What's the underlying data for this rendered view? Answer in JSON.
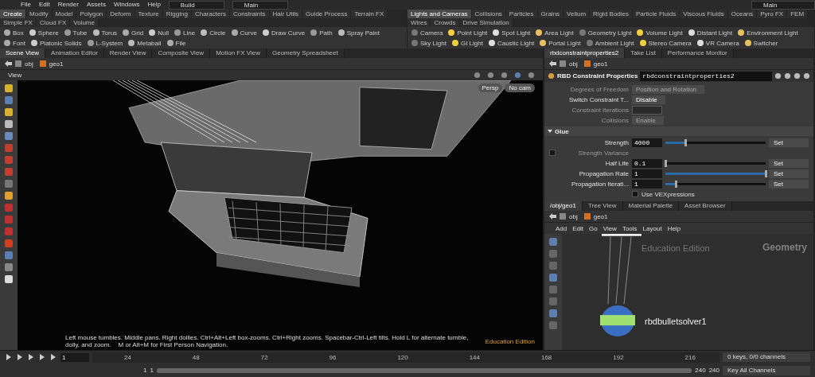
{
  "menu": [
    "File",
    "Edit",
    "Render",
    "Assets",
    "Windows",
    "Help"
  ],
  "desktops": [
    "Build",
    "Main",
    "Main"
  ],
  "shelf_left": {
    "tabs": [
      {
        "label": "Create",
        "selected": true
      },
      {
        "label": "Modify",
        "selected": false
      },
      {
        "label": "Model",
        "selected": false
      },
      {
        "label": "Polygon",
        "selected": false
      },
      {
        "label": "Deform",
        "selected": false
      },
      {
        "label": "Texture",
        "selected": false
      },
      {
        "label": "Rigging",
        "selected": false
      },
      {
        "label": "Characters",
        "selected": false
      },
      {
        "label": "Constraints",
        "selected": false
      },
      {
        "label": "Hair Utils",
        "selected": false
      },
      {
        "label": "Guide Process",
        "selected": false
      },
      {
        "label": "Terrain FX",
        "selected": false
      },
      {
        "label": "Simple FX",
        "selected": false
      },
      {
        "label": "Cloud FX",
        "selected": false
      },
      {
        "label": "Volume",
        "selected": false
      }
    ],
    "tools": [
      "Box",
      "Sphere",
      "Tube",
      "Torus",
      "Grid",
      "Null",
      "Line",
      "Circle",
      "Curve",
      "Draw Curve",
      "Path",
      "Spray Paint",
      "Font",
      "Platonic Solids",
      "L-System",
      "Metaball",
      "File"
    ]
  },
  "shelf_right": {
    "tabs": [
      {
        "label": "Lights and Cameras",
        "selected": true
      },
      {
        "label": "Collisions",
        "selected": false
      },
      {
        "label": "Particles",
        "selected": false
      },
      {
        "label": "Grains",
        "selected": false
      },
      {
        "label": "Vellum",
        "selected": false
      },
      {
        "label": "Rigid Bodies",
        "selected": false
      },
      {
        "label": "Particle Fluids",
        "selected": false
      },
      {
        "label": "Viscous Fluids",
        "selected": false
      },
      {
        "label": "Oceans",
        "selected": false
      },
      {
        "label": "Pyro FX",
        "selected": false
      },
      {
        "label": "FEM",
        "selected": false
      },
      {
        "label": "Wires",
        "selected": false
      },
      {
        "label": "Crowds",
        "selected": false
      },
      {
        "label": "Drive Simulation",
        "selected": false
      }
    ],
    "tools": [
      "Camera",
      "Point Light",
      "Spot Light",
      "Area Light",
      "Geometry Light",
      "Volume Light",
      "Distant Light",
      "Environment Light",
      "Sky Light",
      "GI Light",
      "Caustic Light",
      "Portal Light",
      "Ambient Light",
      "Stereo Camera",
      "VR Camera",
      "Switcher"
    ]
  },
  "scene_pane": {
    "tabs": [
      {
        "label": "Scene View",
        "selected": true
      },
      {
        "label": "Animation Editor",
        "selected": false
      },
      {
        "label": "Render View",
        "selected": false
      },
      {
        "label": "Composite View",
        "selected": false
      },
      {
        "label": "Motion FX View",
        "selected": false
      },
      {
        "label": "Geometry Spreadsheet",
        "selected": false
      }
    ],
    "path": [
      "obj",
      "geo1"
    ],
    "view_title": "View",
    "view_buttons": [
      "Persp",
      "No cam"
    ],
    "hint": "Left mouse tumbles. Middle pans. Right dollies. Ctrl+Alt+Left box-zooms. Ctrl+Right zooms. Spacebar-Ctrl-Left tilts. Hold L for alternate tumble, dolly, and zoom.    M or Alt+M for First Person Navigation.",
    "edition": "Education Edition"
  },
  "param_pane": {
    "tabs": [
      {
        "label": "rbdconstraintproperties2",
        "selected": true
      },
      {
        "label": "Take List",
        "selected": false
      },
      {
        "label": "Performance Monitor",
        "selected": false
      }
    ],
    "path": [
      "obj",
      "geo1"
    ],
    "node_type": "RBD Constraint Properties",
    "node_name": "rbdconstraintproperties2",
    "params": [
      {
        "kind": "menu",
        "label": "Degrees of Freedom",
        "value": "Position and Rotation",
        "disabled": true
      },
      {
        "kind": "menu",
        "label": "Switch Constraint T...",
        "value": "Disable",
        "disabled": false
      },
      {
        "kind": "field",
        "label": "Constraint Iterations",
        "disabled": true
      },
      {
        "kind": "menu",
        "label": "Collisions",
        "value": "Enable",
        "disabled": true
      }
    ],
    "section": {
      "label": "Glue",
      "expanded": true
    },
    "glue": [
      {
        "label": "Strength",
        "value": "4000",
        "level": 0.2,
        "mode": "Set",
        "disabled": false
      },
      {
        "label": "Strength Variance",
        "disabled": true,
        "checked": false
      },
      {
        "label": "Half Life",
        "value": "0.1",
        "level": 0.0,
        "mode": "Set",
        "disabled": false
      },
      {
        "label": "Propagation Rate",
        "value": "1",
        "level": 1.0,
        "mode": "Set",
        "disabled": false
      },
      {
        "label": "Propagation Iterati...",
        "value": "1",
        "level": 0.1,
        "mode": "Set",
        "disabled": false
      }
    ],
    "vex": {
      "label": "Use VEXpressions",
      "checked": false
    }
  },
  "network_pane": {
    "tabs": [
      {
        "label": "/obj/geo1",
        "selected": true
      },
      {
        "label": "Tree View",
        "selected": false
      },
      {
        "label": "Material Palette",
        "selected": false
      },
      {
        "label": "Asset Browser",
        "selected": false
      }
    ],
    "path": [
      "obj",
      "geo1"
    ],
    "menu": [
      "Add",
      "Edit",
      "Go",
      "View",
      "Tools",
      "Layout",
      "Help"
    ],
    "watermark": "Education Edition",
    "context": "Geometry",
    "node": "rbdbulletsolver1"
  },
  "timeline": {
    "frame": "1",
    "range": {
      "level": 1.0
    },
    "ticks": [
      "24",
      "48",
      "72",
      "96",
      "120",
      "144",
      "168",
      "192",
      "216"
    ],
    "start": "1",
    "start2": "1",
    "end": "240",
    "end2": "240",
    "keys": "0 keys, 0/0 channels",
    "key_all": "Key All Channels"
  }
}
